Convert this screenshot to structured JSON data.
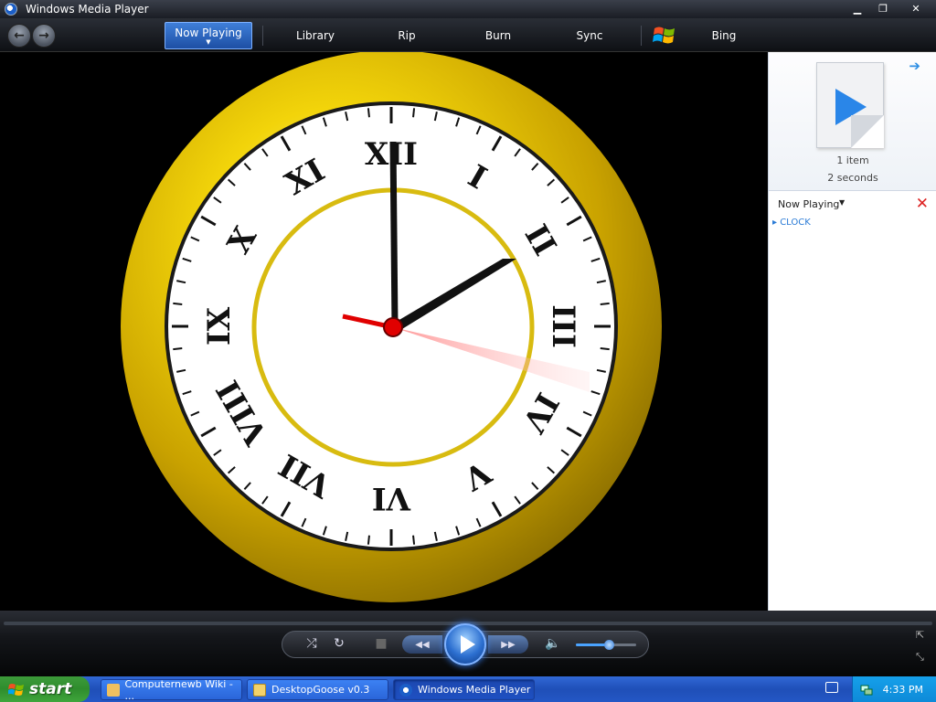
{
  "window": {
    "title": "Windows Media Player",
    "controls": [
      "minimize",
      "restore",
      "close"
    ]
  },
  "nav": {
    "tabs": [
      {
        "label": "Now Playing",
        "active": true
      },
      {
        "label": "Library"
      },
      {
        "label": "Rip"
      },
      {
        "label": "Burn"
      },
      {
        "label": "Sync"
      },
      {
        "label": "Bing"
      }
    ]
  },
  "video": {
    "content": "Animated analog clock with Roman numerals",
    "numerals": [
      "XII",
      "I",
      "II",
      "III",
      "IV",
      "V",
      "VI",
      "VII",
      "VIII",
      "IX",
      "X",
      "XI"
    ],
    "time_shown": "2:00",
    "colors": {
      "bezel": "#e8c400",
      "face": "#ffffff",
      "hands": "#111111",
      "second_hand": "#e00000"
    }
  },
  "pane": {
    "item_count": "1 item",
    "duration": "2 seconds",
    "list_title": "Now Playing",
    "items": [
      "CLOCK"
    ],
    "arrow_icon": "forward-arrow-icon",
    "clear_icon": "clear-list-icon"
  },
  "controls": {
    "shuffle": "⤮",
    "repeat": "↻",
    "stop": "■",
    "prev": "◀◀",
    "next": "▶▶",
    "mute": "🔈",
    "volume": 0.55,
    "accent": "#3a86ff"
  },
  "taskbar": {
    "start_label": "start",
    "tasks": [
      {
        "label": "Computernewb Wiki - ...",
        "icon": "browser-icon"
      },
      {
        "label": "DesktopGoose v0.3",
        "icon": "folder-icon"
      },
      {
        "label": "Windows Media Player",
        "icon": "wmp-icon",
        "active": true
      }
    ],
    "clock": "4:33 PM"
  }
}
